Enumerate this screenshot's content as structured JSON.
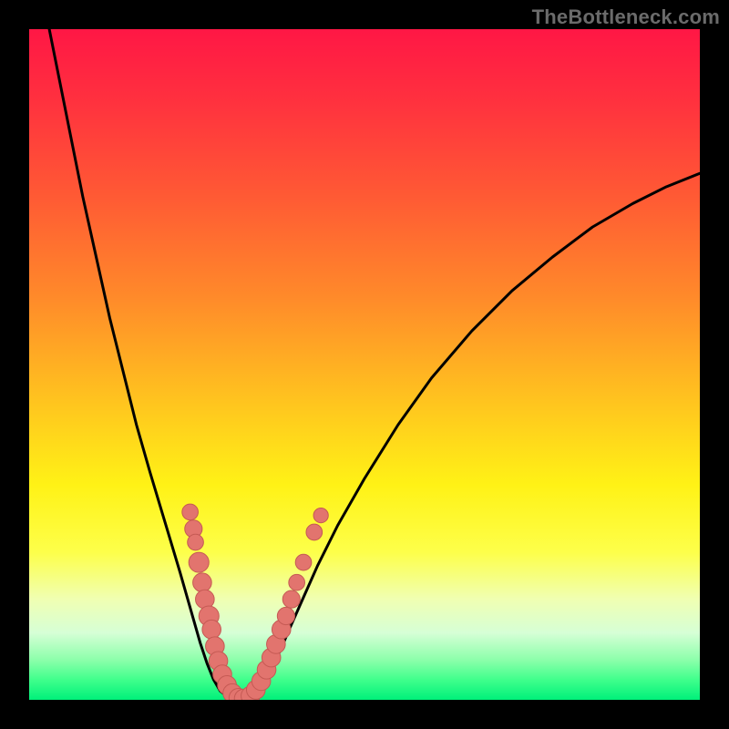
{
  "watermark": "TheBottleneck.com",
  "colors": {
    "curve": "#000000",
    "dot_fill": "#e2746e",
    "dot_stroke": "#c55a54",
    "gradient_stops": [
      {
        "offset": 0.0,
        "color": "#ff1745"
      },
      {
        "offset": 0.1,
        "color": "#ff2f3f"
      },
      {
        "offset": 0.25,
        "color": "#ff5a34"
      },
      {
        "offset": 0.4,
        "color": "#ff8a2a"
      },
      {
        "offset": 0.55,
        "color": "#ffc21f"
      },
      {
        "offset": 0.68,
        "color": "#fff216"
      },
      {
        "offset": 0.78,
        "color": "#fdff4a"
      },
      {
        "offset": 0.85,
        "color": "#f0ffb2"
      },
      {
        "offset": 0.9,
        "color": "#d6ffd6"
      },
      {
        "offset": 0.94,
        "color": "#8dffab"
      },
      {
        "offset": 0.97,
        "color": "#40ff8c"
      },
      {
        "offset": 1.0,
        "color": "#00f07a"
      }
    ]
  },
  "chart_data": {
    "type": "line",
    "title": "",
    "xlabel": "",
    "ylabel": "",
    "xlim": [
      0,
      100
    ],
    "ylim": [
      0,
      100
    ],
    "grid": false,
    "legend": false,
    "curve_points": [
      {
        "x": 3.0,
        "y": 100.0
      },
      {
        "x": 4.0,
        "y": 95.0
      },
      {
        "x": 6.0,
        "y": 85.0
      },
      {
        "x": 8.0,
        "y": 75.0
      },
      {
        "x": 10.0,
        "y": 66.0
      },
      {
        "x": 12.0,
        "y": 57.0
      },
      {
        "x": 14.0,
        "y": 49.0
      },
      {
        "x": 16.0,
        "y": 41.0
      },
      {
        "x": 18.0,
        "y": 34.0
      },
      {
        "x": 19.5,
        "y": 29.0
      },
      {
        "x": 21.0,
        "y": 24.0
      },
      {
        "x": 22.5,
        "y": 19.0
      },
      {
        "x": 23.5,
        "y": 15.5
      },
      {
        "x": 24.5,
        "y": 12.0
      },
      {
        "x": 25.5,
        "y": 8.5
      },
      {
        "x": 26.5,
        "y": 5.5
      },
      {
        "x": 27.5,
        "y": 3.0
      },
      {
        "x": 28.5,
        "y": 1.3
      },
      {
        "x": 30.0,
        "y": 0.2
      },
      {
        "x": 31.5,
        "y": 0.0
      },
      {
        "x": 33.0,
        "y": 0.5
      },
      {
        "x": 34.5,
        "y": 2.0
      },
      {
        "x": 36.0,
        "y": 4.5
      },
      {
        "x": 37.5,
        "y": 7.5
      },
      {
        "x": 39.0,
        "y": 11.0
      },
      {
        "x": 41.0,
        "y": 15.5
      },
      {
        "x": 43.0,
        "y": 20.0
      },
      {
        "x": 46.0,
        "y": 26.0
      },
      {
        "x": 50.0,
        "y": 33.0
      },
      {
        "x": 55.0,
        "y": 41.0
      },
      {
        "x": 60.0,
        "y": 48.0
      },
      {
        "x": 66.0,
        "y": 55.0
      },
      {
        "x": 72.0,
        "y": 61.0
      },
      {
        "x": 78.0,
        "y": 66.0
      },
      {
        "x": 84.0,
        "y": 70.5
      },
      {
        "x": 90.0,
        "y": 74.0
      },
      {
        "x": 95.0,
        "y": 76.5
      },
      {
        "x": 100.0,
        "y": 78.5
      }
    ],
    "dots": [
      {
        "x": 24.0,
        "y": 28.0,
        "r": 1.2
      },
      {
        "x": 24.5,
        "y": 25.5,
        "r": 1.3
      },
      {
        "x": 24.8,
        "y": 23.5,
        "r": 1.2
      },
      {
        "x": 25.3,
        "y": 20.5,
        "r": 1.5
      },
      {
        "x": 25.8,
        "y": 17.5,
        "r": 1.4
      },
      {
        "x": 26.2,
        "y": 15.0,
        "r": 1.4
      },
      {
        "x": 26.8,
        "y": 12.5,
        "r": 1.5
      },
      {
        "x": 27.2,
        "y": 10.5,
        "r": 1.4
      },
      {
        "x": 27.7,
        "y": 8.0,
        "r": 1.4
      },
      {
        "x": 28.2,
        "y": 5.8,
        "r": 1.4
      },
      {
        "x": 28.8,
        "y": 3.8,
        "r": 1.4
      },
      {
        "x": 29.5,
        "y": 2.2,
        "r": 1.4
      },
      {
        "x": 30.3,
        "y": 1.0,
        "r": 1.4
      },
      {
        "x": 31.2,
        "y": 0.3,
        "r": 1.4
      },
      {
        "x": 32.0,
        "y": 0.2,
        "r": 1.4
      },
      {
        "x": 33.0,
        "y": 0.6,
        "r": 1.4
      },
      {
        "x": 33.8,
        "y": 1.5,
        "r": 1.4
      },
      {
        "x": 34.6,
        "y": 2.8,
        "r": 1.4
      },
      {
        "x": 35.4,
        "y": 4.5,
        "r": 1.4
      },
      {
        "x": 36.1,
        "y": 6.3,
        "r": 1.4
      },
      {
        "x": 36.8,
        "y": 8.3,
        "r": 1.4
      },
      {
        "x": 37.6,
        "y": 10.5,
        "r": 1.4
      },
      {
        "x": 38.3,
        "y": 12.5,
        "r": 1.3
      },
      {
        "x": 39.1,
        "y": 15.0,
        "r": 1.3
      },
      {
        "x": 39.9,
        "y": 17.5,
        "r": 1.2
      },
      {
        "x": 40.9,
        "y": 20.5,
        "r": 1.2
      },
      {
        "x": 42.5,
        "y": 25.0,
        "r": 1.2
      },
      {
        "x": 43.5,
        "y": 27.5,
        "r": 1.1
      }
    ]
  }
}
